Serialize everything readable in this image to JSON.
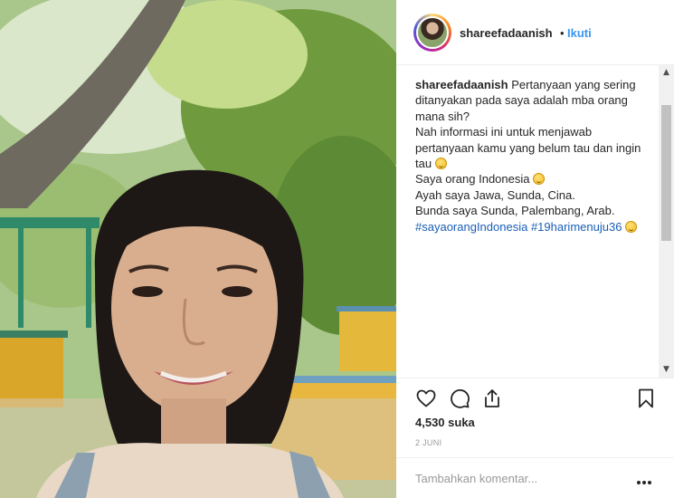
{
  "post": {
    "image_alt": "Selfie photo",
    "header": {
      "username": "shareefadaanish",
      "separator": "•",
      "follow_label": "Ikuti"
    },
    "caption": {
      "username": "shareefadaanish",
      "line1": "Pertanyaan yang sering",
      "line2": "ditanyakan pada saya adalah mba orang",
      "line3": "mana sih?",
      "line4": "Nah informasi ini untuk menjawab",
      "line5": "pertanyaan kamu yang belum tau dan ingin",
      "line6": "tau",
      "line7": "Saya orang Indonesia",
      "line8": "Ayah saya Jawa, Sunda, Cina.",
      "line9": "Bunda saya Sunda, Palembang, Arab.",
      "hashtag1": "#sayaorangIndonesia",
      "hashtag2": "#19harimenuju36"
    },
    "likes": "4,530 suka",
    "date": "2 JUNI",
    "comment": {
      "placeholder": "Tambahkan komentar...",
      "value": ""
    },
    "icons": {
      "like": "heart-icon",
      "comment": "comment-icon",
      "share": "share-icon",
      "save": "bookmark-icon",
      "more": "more-options-icon"
    },
    "colors": {
      "link": "#3897f0",
      "hashtag": "#1a5fb4",
      "text": "#262626",
      "muted": "#999999"
    }
  }
}
